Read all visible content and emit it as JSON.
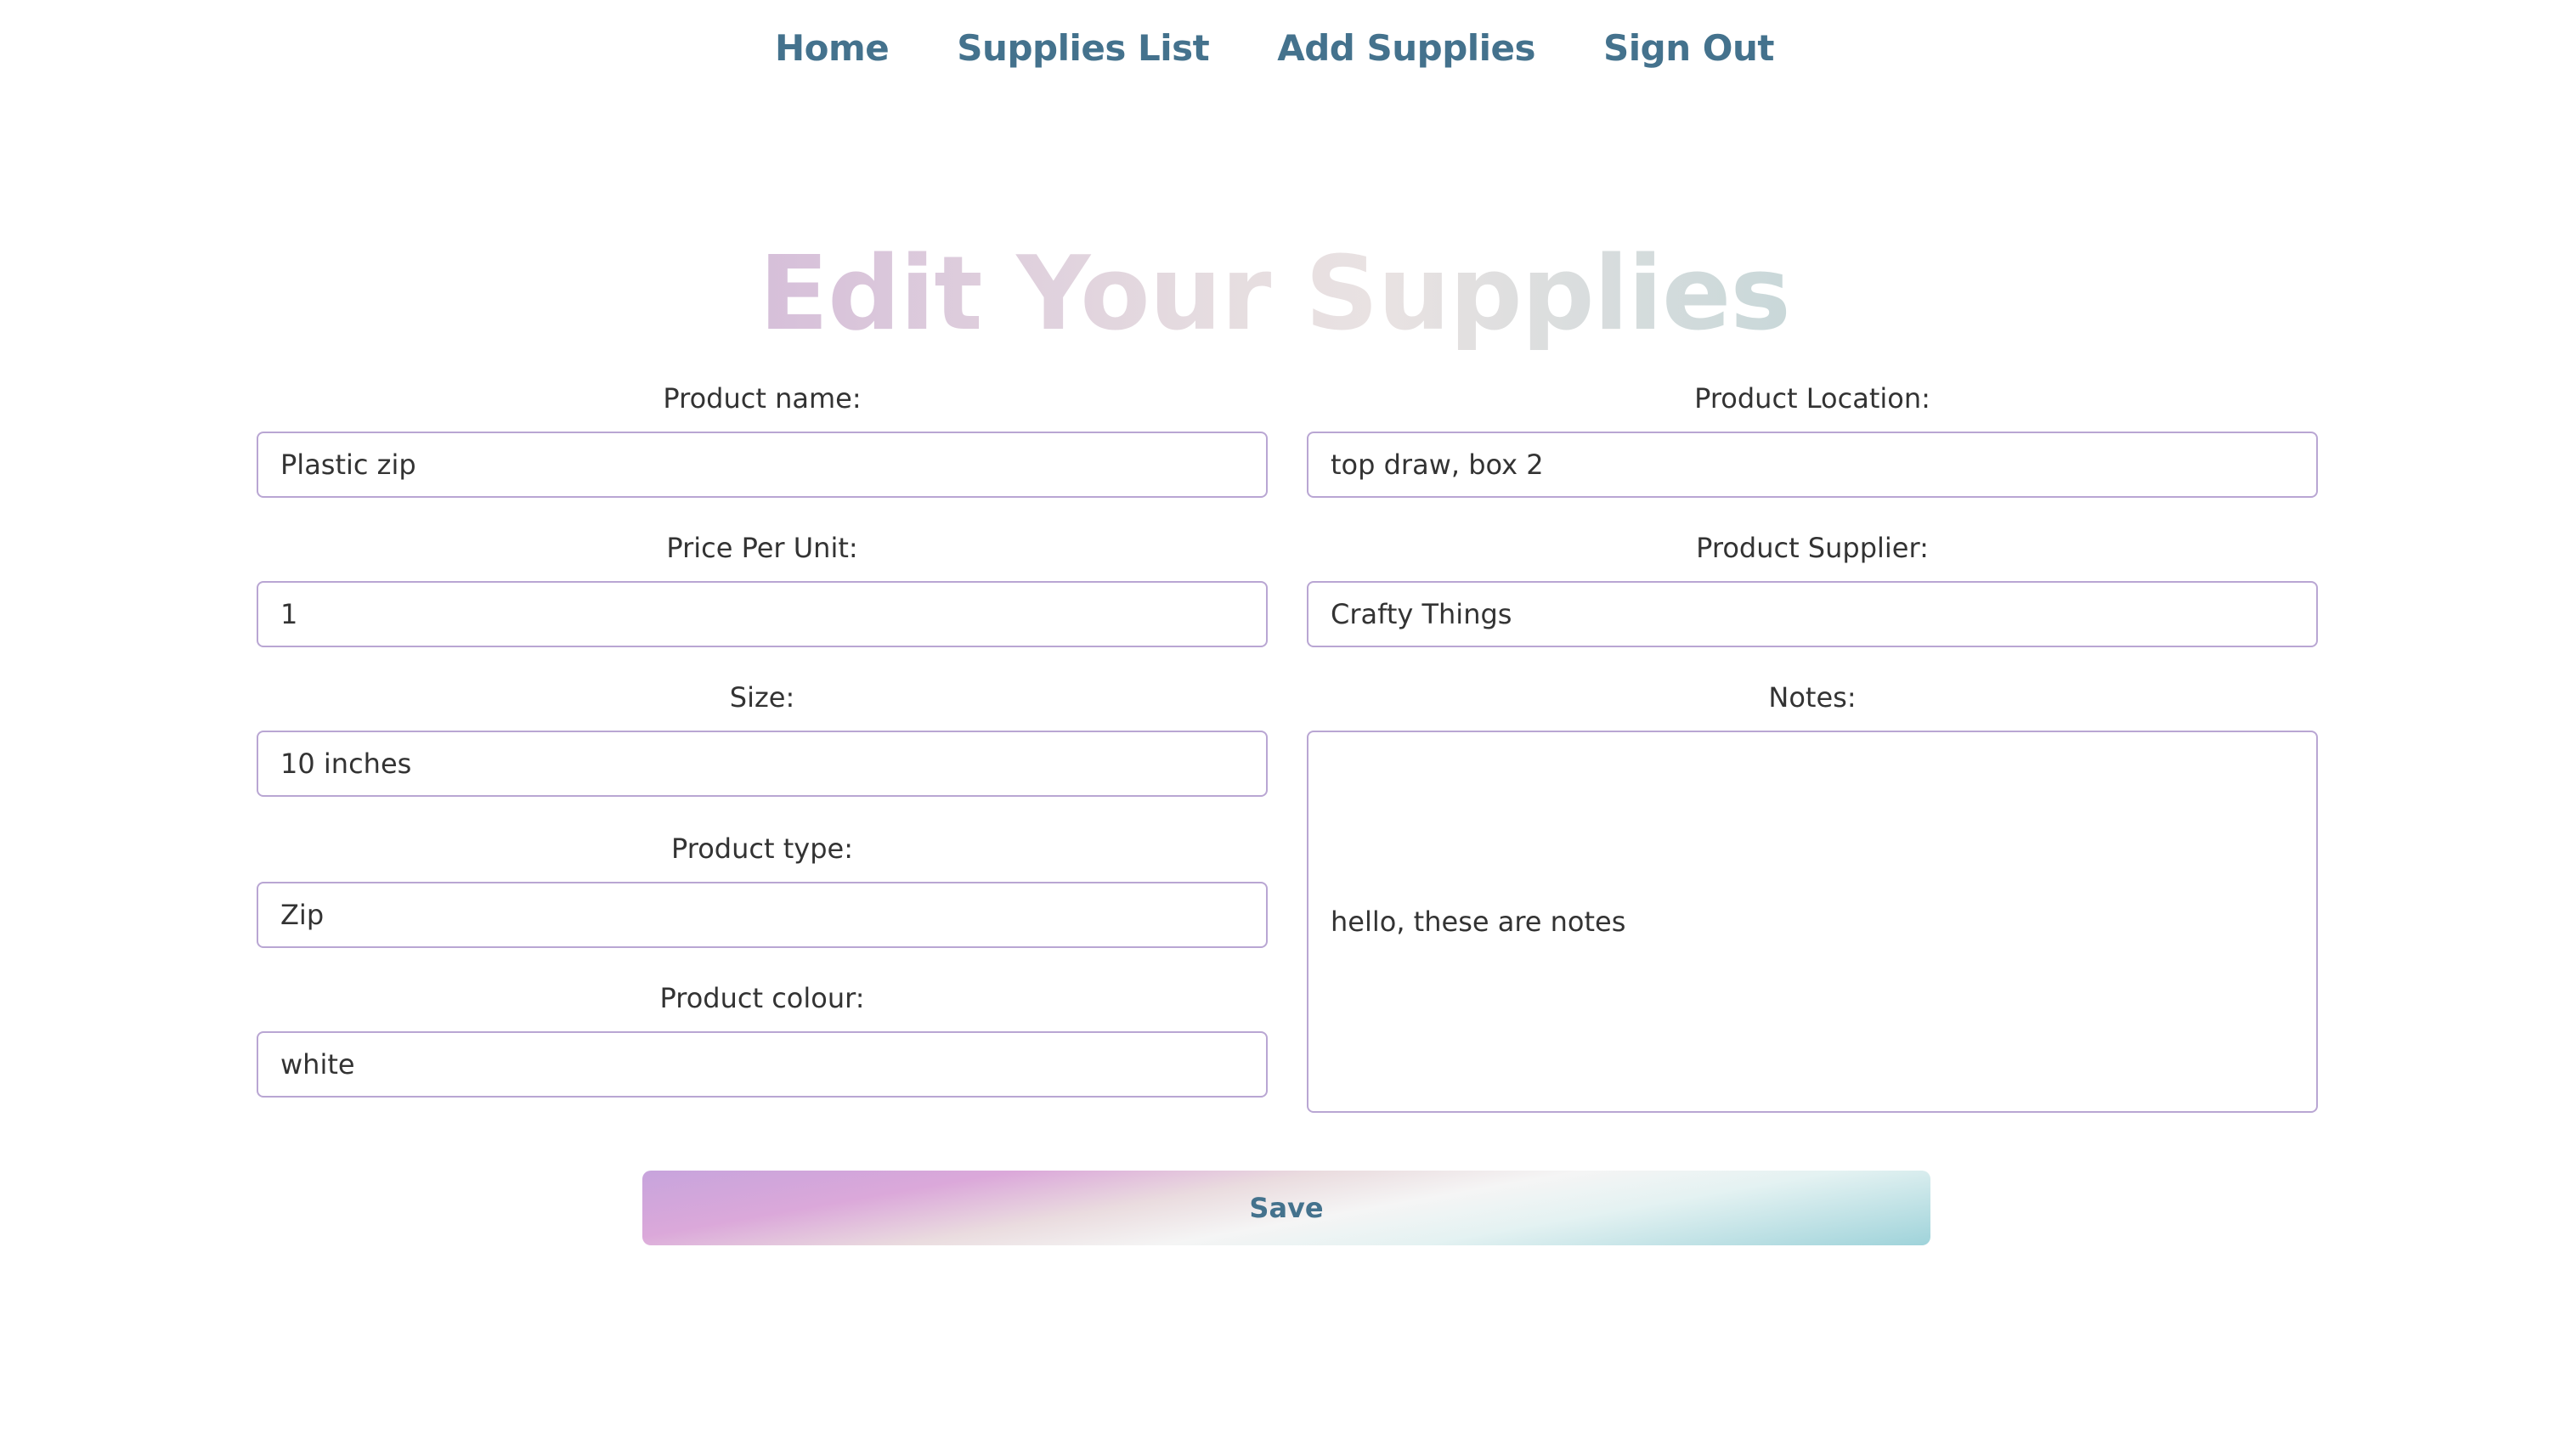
{
  "nav": {
    "items": [
      {
        "label": "Home"
      },
      {
        "label": "Supplies List"
      },
      {
        "label": "Add Supplies"
      },
      {
        "label": "Sign Out"
      }
    ]
  },
  "page": {
    "title": "Edit Your Supplies"
  },
  "form": {
    "left": [
      {
        "label": "Product name:",
        "value": "Plastic zip"
      },
      {
        "label": "Price Per Unit:",
        "value": "1"
      },
      {
        "label": "Size:",
        "value": "10 inches"
      },
      {
        "label": "Product type:",
        "value": "Zip"
      },
      {
        "label": "Product colour:",
        "value": "white"
      }
    ],
    "right": [
      {
        "label": "Product Location:",
        "value": "top draw, box 2"
      },
      {
        "label": "Product Supplier:",
        "value": "Crafty Things"
      },
      {
        "label": "Notes:",
        "value": "hello, these are notes"
      }
    ],
    "save_label": "Save"
  },
  "colors": {
    "nav_link": "#44728d",
    "input_border": "#b9a6d3",
    "text": "#333333"
  }
}
